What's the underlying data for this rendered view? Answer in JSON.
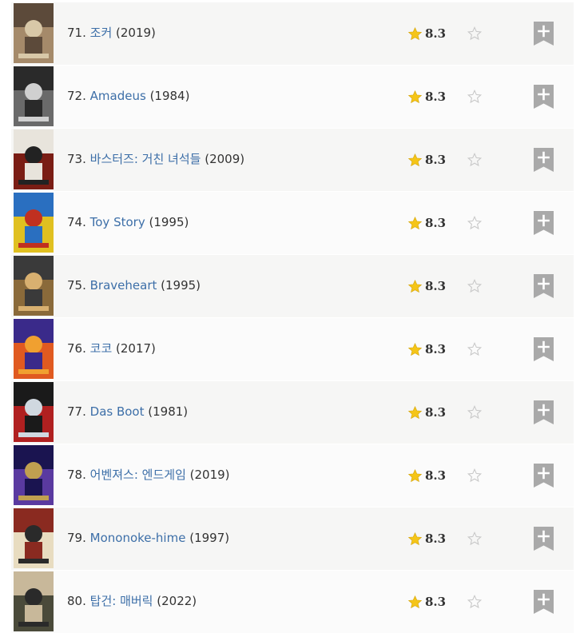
{
  "chart": {
    "rows": [
      {
        "rank": "71.",
        "title": "조커",
        "year": "(2019)",
        "rating": "8.3",
        "poster_colors": [
          "#5c4a3a",
          "#a58a6a",
          "#d8c8a8"
        ]
      },
      {
        "rank": "72.",
        "title": "Amadeus",
        "year": "(1984)",
        "rating": "8.3",
        "poster_colors": [
          "#2a2a2a",
          "#6a6a6a",
          "#d0d0d0"
        ]
      },
      {
        "rank": "73.",
        "title": "바스터즈: 거친 녀석들",
        "year": "(2009)",
        "rating": "8.3",
        "poster_colors": [
          "#e8e4dc",
          "#7a1d14",
          "#222222"
        ]
      },
      {
        "rank": "74.",
        "title": "Toy Story",
        "year": "(1995)",
        "rating": "8.3",
        "poster_colors": [
          "#2a6fc0",
          "#e0c020",
          "#c03020"
        ]
      },
      {
        "rank": "75.",
        "title": "Braveheart",
        "year": "(1995)",
        "rating": "8.3",
        "poster_colors": [
          "#3a3a3a",
          "#8a6a3a",
          "#d8b070"
        ]
      },
      {
        "rank": "76.",
        "title": "코코",
        "year": "(2017)",
        "rating": "8.3",
        "poster_colors": [
          "#3a2a8a",
          "#e05a20",
          "#f0a030"
        ]
      },
      {
        "rank": "77.",
        "title": "Das Boot",
        "year": "(1981)",
        "rating": "8.3",
        "poster_colors": [
          "#1a1a1a",
          "#b02020",
          "#d0d8e0"
        ]
      },
      {
        "rank": "78.",
        "title": "어벤져스: 엔드게임",
        "year": "(2019)",
        "rating": "8.3",
        "poster_colors": [
          "#1a1450",
          "#5a3aa0",
          "#c0a050"
        ]
      },
      {
        "rank": "79.",
        "title": "Mononoke-hime",
        "year": "(1997)",
        "rating": "8.3",
        "poster_colors": [
          "#8a2a20",
          "#e8dcc0",
          "#2a2a2a"
        ]
      },
      {
        "rank": "80.",
        "title": "탑건: 매버릭",
        "year": "(2022)",
        "rating": "8.3",
        "poster_colors": [
          "#c8b89a",
          "#4a4a3a",
          "#2a2a2a"
        ]
      }
    ]
  },
  "icons": {
    "rating": "star-icon",
    "rate": "star-outline-icon",
    "watchlist": "bookmark-plus-icon"
  },
  "colors": {
    "link": "#3d6fa8",
    "star_gold": "#f5c518",
    "row_odd": "#f6f6f5",
    "row_even": "#fbfbfb",
    "watchlist_gray": "#a9a9a9"
  }
}
